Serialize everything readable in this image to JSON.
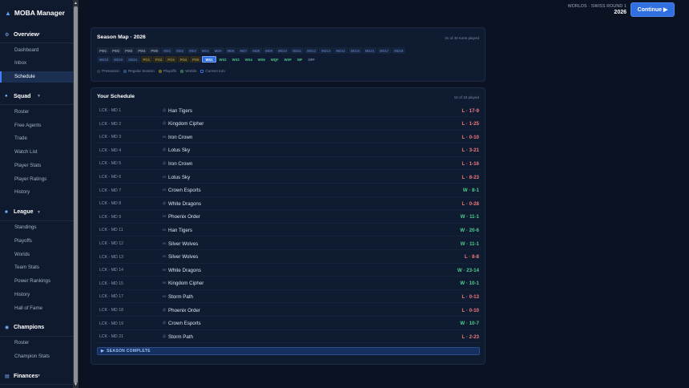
{
  "app": {
    "title": "MOBA Manager",
    "logo_icon": "triangle-logo-icon"
  },
  "sidebar": {
    "sections": [
      {
        "label": "Overview",
        "icon": "gear-icon",
        "items": [
          "Dashboard",
          "Inbox",
          "Schedule"
        ],
        "active": "Schedule"
      },
      {
        "label": "Squad",
        "icon": "person-icon",
        "items": [
          "Roster",
          "Free Agents",
          "Trade",
          "Watch List",
          "Player Stats",
          "Player Ratings",
          "History"
        ]
      },
      {
        "label": "League",
        "icon": "trophy-icon",
        "items": [
          "Standings",
          "Playoffs",
          "Worlds",
          "Team Stats",
          "Power Rankings",
          "History",
          "Hall of Fame"
        ]
      },
      {
        "label": "Champions",
        "icon": "globe-icon",
        "items": [
          "Roster",
          "Champion Stats"
        ]
      },
      {
        "label": "Finances",
        "icon": "money-icon",
        "items": [
          "Team Finances"
        ]
      }
    ]
  },
  "header": {
    "event": "WORLDS · SWISS ROUND 1",
    "year": "2026",
    "continue_label": "Continue ▶"
  },
  "season_map": {
    "title": "Season Map · 2026",
    "turns": "31 of 40 turns played",
    "row1": [
      {
        "l": "PW1",
        "k": "pre"
      },
      {
        "l": "PW2",
        "k": "pre"
      },
      {
        "l": "PW3",
        "k": "pre"
      },
      {
        "l": "PW4",
        "k": "pre"
      },
      {
        "l": "PW5",
        "k": "pre"
      },
      {
        "l": "MD1",
        "k": "reg"
      },
      {
        "l": "MD2",
        "k": "reg"
      },
      {
        "l": "MD3",
        "k": "reg"
      },
      {
        "l": "MD4",
        "k": "reg"
      },
      {
        "l": "MD5",
        "k": "reg"
      },
      {
        "l": "MD6",
        "k": "reg"
      },
      {
        "l": "MD7",
        "k": "reg"
      },
      {
        "l": "MD8",
        "k": "reg"
      },
      {
        "l": "MD9",
        "k": "reg"
      },
      {
        "l": "MD10",
        "k": "reg"
      },
      {
        "l": "MD11",
        "k": "reg"
      },
      {
        "l": "MD12",
        "k": "reg"
      },
      {
        "l": "MD13",
        "k": "reg"
      },
      {
        "l": "MD14",
        "k": "reg"
      },
      {
        "l": "MD15",
        "k": "reg"
      },
      {
        "l": "MD16",
        "k": "reg"
      },
      {
        "l": "MD17",
        "k": "reg"
      },
      {
        "l": "MD18",
        "k": "reg"
      }
    ],
    "row2": [
      {
        "l": "MD19",
        "k": "reg"
      },
      {
        "l": "MD20",
        "k": "reg"
      },
      {
        "l": "MD21",
        "k": "reg"
      },
      {
        "l": "PO1",
        "k": "po"
      },
      {
        "l": "PO2",
        "k": "po"
      },
      {
        "l": "PO3",
        "k": "po"
      },
      {
        "l": "PO4",
        "k": "po"
      },
      {
        "l": "PO5",
        "k": "po"
      },
      {
        "l": "WS1",
        "k": "cur"
      },
      {
        "l": "WS2",
        "k": "wl"
      },
      {
        "l": "WS3",
        "k": "wl"
      },
      {
        "l": "WS4",
        "k": "wl"
      },
      {
        "l": "WS5",
        "k": "wl"
      },
      {
        "l": "WQF",
        "k": "wl"
      },
      {
        "l": "WSF",
        "k": "wl"
      },
      {
        "l": "WF",
        "k": "wl"
      },
      {
        "l": "OFF",
        "k": "off"
      }
    ],
    "legend": [
      {
        "label": "Preseason",
        "color": "#2a364a"
      },
      {
        "label": "Regular Season",
        "color": "#2c4a7c"
      },
      {
        "label": "Playoffs",
        "color": "#6b5f2c"
      },
      {
        "label": "Worlds",
        "color": "#2f6b4e"
      },
      {
        "label": "Current turn",
        "color": "#2f6fe0"
      }
    ]
  },
  "schedule": {
    "title": "Your Schedule",
    "played": "16 of 18 played",
    "rows": [
      {
        "md": "LCK - MD 1",
        "vs": "@",
        "team": "Han Tigers",
        "result": "L · 17-9",
        "win": false
      },
      {
        "md": "LCK - MD 2",
        "vs": "@",
        "team": "Kingdom Cipher",
        "result": "L · 1-25",
        "win": false
      },
      {
        "md": "LCK - MD 3",
        "vs": "vs",
        "team": "Iron Crown",
        "result": "L · 0-10",
        "win": false
      },
      {
        "md": "LCK - MD 4",
        "vs": "@",
        "team": "Lotus Sky",
        "result": "L · 3-21",
        "win": false
      },
      {
        "md": "LCK - MD 5",
        "vs": "@",
        "team": "Iron Crown",
        "result": "L · 1-16",
        "win": false
      },
      {
        "md": "LCK - MD 6",
        "vs": "vs",
        "team": "Lotus Sky",
        "result": "L · 8-23",
        "win": false
      },
      {
        "md": "LCK - MD 7",
        "vs": "vs",
        "team": "Crown Esports",
        "result": "W · 8-1",
        "win": true
      },
      {
        "md": "LCK - MD 8",
        "vs": "@",
        "team": "White Dragons",
        "result": "L · 0-28",
        "win": false
      },
      {
        "md": "LCK - MD 9",
        "vs": "vs",
        "team": "Phoenix Order",
        "result": "W · 11-1",
        "win": true
      },
      {
        "md": "LCK - MD 11",
        "vs": "vs",
        "team": "Han Tigers",
        "result": "W · 20-6",
        "win": true
      },
      {
        "md": "LCK - MD 12",
        "vs": "vs",
        "team": "Silver Wolves",
        "result": "W · 11-1",
        "win": true
      },
      {
        "md": "LCK - MD 13",
        "vs": "vs",
        "team": "Silver Wolves",
        "result": "L · 8-8",
        "win": false
      },
      {
        "md": "LCK - MD 14",
        "vs": "vs",
        "team": "White Dragons",
        "result": "W · 23-14",
        "win": true
      },
      {
        "md": "LCK - MD 15",
        "vs": "vs",
        "team": "Kingdom Cipher",
        "result": "W · 10-1",
        "win": true
      },
      {
        "md": "LCK - MD 17",
        "vs": "vs",
        "team": "Storm Path",
        "result": "L · 0-13",
        "win": false
      },
      {
        "md": "LCK - MD 18",
        "vs": "@",
        "team": "Phoenix Order",
        "result": "L · 0-10",
        "win": false
      },
      {
        "md": "LCK - MD 19",
        "vs": "@",
        "team": "Crown Esports",
        "result": "W · 10-7",
        "win": true
      },
      {
        "md": "LCK - MD 21",
        "vs": "@",
        "team": "Storm Path",
        "result": "L · 2-23",
        "win": false
      }
    ],
    "season_complete": "SEASON COMPLETE"
  }
}
